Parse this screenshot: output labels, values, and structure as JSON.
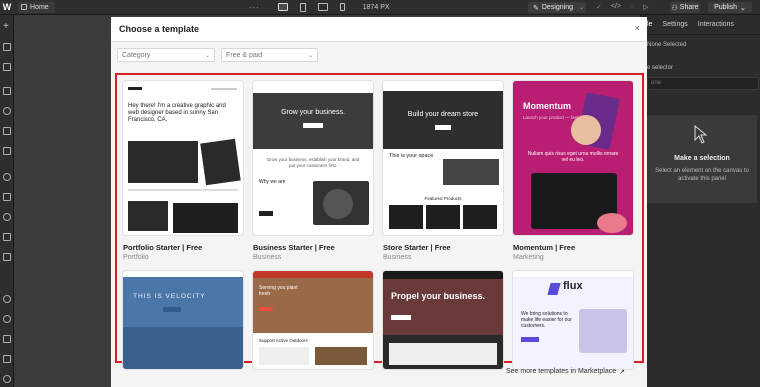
{
  "topbar": {
    "logo": "W",
    "home_label": "Home",
    "more_dots": "···",
    "zoom_width": "1874 PX",
    "mode_label": "Designing",
    "share_label": "Share",
    "publish_label": "Publish"
  },
  "right_panel": {
    "tabs": [
      "Style",
      "Settings",
      "Interactions"
    ],
    "tab_style_visible": "le",
    "none_selected": "None Selected",
    "selector_label": "e selector",
    "selector_placeholder": "one",
    "make_selection_title": "Make a selection",
    "make_selection_text": "Select an element on the canvas to activate this panel"
  },
  "modal": {
    "title": "Choose a template",
    "close_glyph": "×",
    "filter_category_placeholder": "Category",
    "filter_price_value": "Free & paid",
    "footer_link": "See more templates in Marketplace",
    "footer_arrow": "↗",
    "templates": [
      {
        "name": "Portfolio Starter",
        "price": "Free",
        "category": "Portfolio",
        "headline": "Hey there! I'm a creative graphic and web designer based in sunny San Francisco, CA."
      },
      {
        "name": "Business Starter",
        "price": "Free",
        "category": "Business",
        "headline": "Grow your business.",
        "sub": "Grow your business, establish your brand, and put your customers first.",
        "section": "Why we are"
      },
      {
        "name": "Store Starter",
        "price": "Free",
        "category": "Business",
        "headline": "Build your dream store",
        "sub": "This is your space",
        "section": "Featured Products"
      },
      {
        "name": "Momentum",
        "price": "Free",
        "category": "Marketing",
        "headline": "Momentum",
        "sub": "Launch your product — fast",
        "section": "Nullam quis risus eget urna mollis ornare vel eu leo."
      },
      {
        "name": "",
        "headline": "THIS IS VELOCITY"
      },
      {
        "name": "",
        "headline": "Serving you plant fresh",
        "section": "Support Active Outdoors"
      },
      {
        "name": "",
        "headline": "Propel your business."
      },
      {
        "name": "",
        "headline": "flux",
        "sub": "We bring solutions to make life easier for our customers."
      }
    ]
  }
}
